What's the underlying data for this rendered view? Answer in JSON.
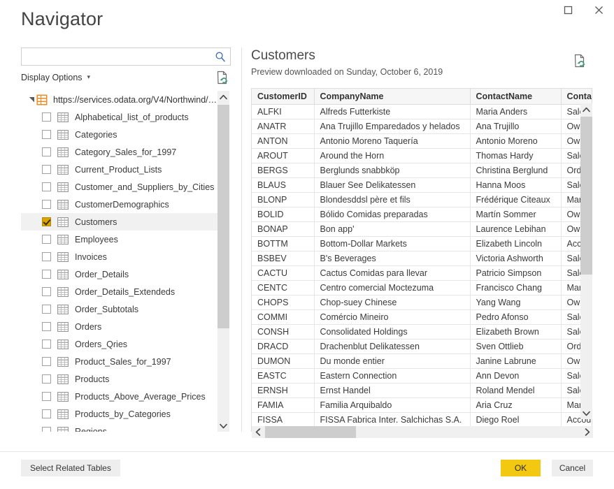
{
  "window": {
    "title": "Navigator",
    "maximize_label": "Maximize",
    "close_label": "Close"
  },
  "left": {
    "search": {
      "value": "",
      "placeholder": "",
      "icon": "search-icon"
    },
    "display_options_label": "Display Options",
    "display_options_caret": "▾",
    "refresh_icon": "refresh-document-icon",
    "tree": {
      "root": {
        "label": "https://services.odata.org/V4/Northwind/N...",
        "expander": "◢",
        "icon": "database-icon",
        "expanded": true
      },
      "items": [
        {
          "label": "Alphabetical_list_of_products",
          "checked": false
        },
        {
          "label": "Categories",
          "checked": false
        },
        {
          "label": "Category_Sales_for_1997",
          "checked": false
        },
        {
          "label": "Current_Product_Lists",
          "checked": false
        },
        {
          "label": "Customer_and_Suppliers_by_Cities",
          "checked": false
        },
        {
          "label": "CustomerDemographics",
          "checked": false
        },
        {
          "label": "Customers",
          "checked": true,
          "selected": true
        },
        {
          "label": "Employees",
          "checked": false
        },
        {
          "label": "Invoices",
          "checked": false
        },
        {
          "label": "Order_Details",
          "checked": false
        },
        {
          "label": "Order_Details_Extendeds",
          "checked": false
        },
        {
          "label": "Order_Subtotals",
          "checked": false
        },
        {
          "label": "Orders",
          "checked": false
        },
        {
          "label": "Orders_Qries",
          "checked": false
        },
        {
          "label": "Product_Sales_for_1997",
          "checked": false
        },
        {
          "label": "Products",
          "checked": false
        },
        {
          "label": "Products_Above_Average_Prices",
          "checked": false
        },
        {
          "label": "Products_by_Categories",
          "checked": false
        },
        {
          "label": "Regions",
          "checked": false
        }
      ]
    },
    "scrollbar": {
      "up": "⌃",
      "down": "⌄"
    }
  },
  "right": {
    "title": "Customers",
    "subtitle": "Preview downloaded on Sunday, October 6, 2019",
    "refresh_icon": "refresh-document-icon",
    "columns": [
      "CustomerID",
      "CompanyName",
      "ContactName",
      "ContactTitle"
    ],
    "rows": [
      [
        "ALFKI",
        "Alfreds Futterkiste",
        "Maria Anders",
        "Sales Representative"
      ],
      [
        "ANATR",
        "Ana Trujillo Emparedados y helados",
        "Ana Trujillo",
        "Owner"
      ],
      [
        "ANTON",
        "Antonio Moreno Taquería",
        "Antonio Moreno",
        "Owner"
      ],
      [
        "AROUT",
        "Around the Horn",
        "Thomas Hardy",
        "Sales Representative"
      ],
      [
        "BERGS",
        "Berglunds snabbköp",
        "Christina Berglund",
        "Order Administrator"
      ],
      [
        "BLAUS",
        "Blauer See Delikatessen",
        "Hanna Moos",
        "Sales Representative"
      ],
      [
        "BLONP",
        "Blondesddsl père et fils",
        "Frédérique Citeaux",
        "Marketing Manager"
      ],
      [
        "BOLID",
        "Bólido Comidas preparadas",
        "Martín Sommer",
        "Owner"
      ],
      [
        "BONAP",
        "Bon app'",
        "Laurence Lebihan",
        "Owner"
      ],
      [
        "BOTTM",
        "Bottom-Dollar Markets",
        "Elizabeth Lincoln",
        "Accounting Manager"
      ],
      [
        "BSBEV",
        "B's Beverages",
        "Victoria Ashworth",
        "Sales Representative"
      ],
      [
        "CACTU",
        "Cactus Comidas para llevar",
        "Patricio Simpson",
        "Sales Agent"
      ],
      [
        "CENTC",
        "Centro comercial Moctezuma",
        "Francisco Chang",
        "Marketing Manager"
      ],
      [
        "CHOPS",
        "Chop-suey Chinese",
        "Yang Wang",
        "Owner"
      ],
      [
        "COMMI",
        "Comércio Mineiro",
        "Pedro Afonso",
        "Sales Associate"
      ],
      [
        "CONSH",
        "Consolidated Holdings",
        "Elizabeth Brown",
        "Sales Representative"
      ],
      [
        "DRACD",
        "Drachenblut Delikatessen",
        "Sven Ottlieb",
        "Order Administrator"
      ],
      [
        "DUMON",
        "Du monde entier",
        "Janine Labrune",
        "Owner"
      ],
      [
        "EASTC",
        "Eastern Connection",
        "Ann Devon",
        "Sales Agent"
      ],
      [
        "ERNSH",
        "Ernst Handel",
        "Roland Mendel",
        "Sales Manager"
      ],
      [
        "FAMIA",
        "Familia Arquibaldo",
        "Aria Cruz",
        "Marketing Assistant"
      ],
      [
        "FISSA",
        "FISSA Fabrica Inter. Salchichas S.A.",
        "Diego Roel",
        "Accounting Manager"
      ]
    ],
    "scrollbar": {
      "up": "⌃",
      "down": "⌄",
      "left": "‹",
      "right": "›"
    }
  },
  "footer": {
    "select_related_label": "Select Related Tables",
    "ok_label": "OK",
    "cancel_label": "Cancel"
  },
  "colors": {
    "accent": "#f2c811",
    "checkbox_checked": "#d9a400",
    "table_icon": "#7a7a7a",
    "db_icon": "#e8861e"
  }
}
